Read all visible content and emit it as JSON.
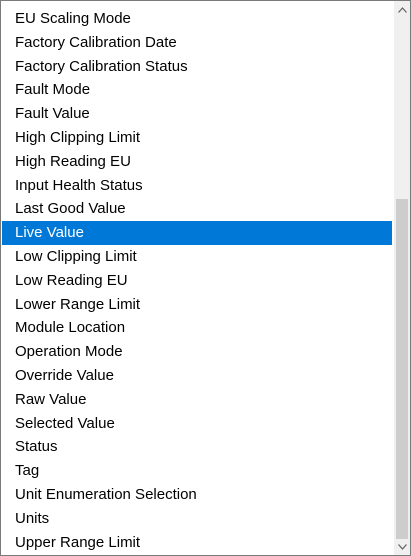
{
  "list": {
    "items": [
      "EU Scaling Mode",
      "Factory Calibration Date",
      "Factory Calibration Status",
      "Fault Mode",
      "Fault Value",
      "High Clipping Limit",
      "High Reading EU",
      "Input Health Status",
      "Last Good Value",
      "Live Value",
      "Low Clipping Limit",
      "Low Reading EU",
      "Lower Range Limit",
      "Module Location",
      "Operation Mode",
      "Override Value",
      "Raw Value",
      "Selected Value",
      "Status",
      "Tag",
      "Unit Enumeration Selection",
      "Units",
      "Upper Range Limit"
    ],
    "selected_index": 9
  },
  "scrollbar": {
    "up_icon": "caret-up-icon",
    "down_icon": "caret-down-icon"
  },
  "colors": {
    "selection_bg": "#0078d7",
    "selection_text": "#ffffff",
    "scrollbar_track": "#f0f0f0",
    "scrollbar_thumb": "#cdcdcd",
    "border": "#7a7a7a"
  }
}
